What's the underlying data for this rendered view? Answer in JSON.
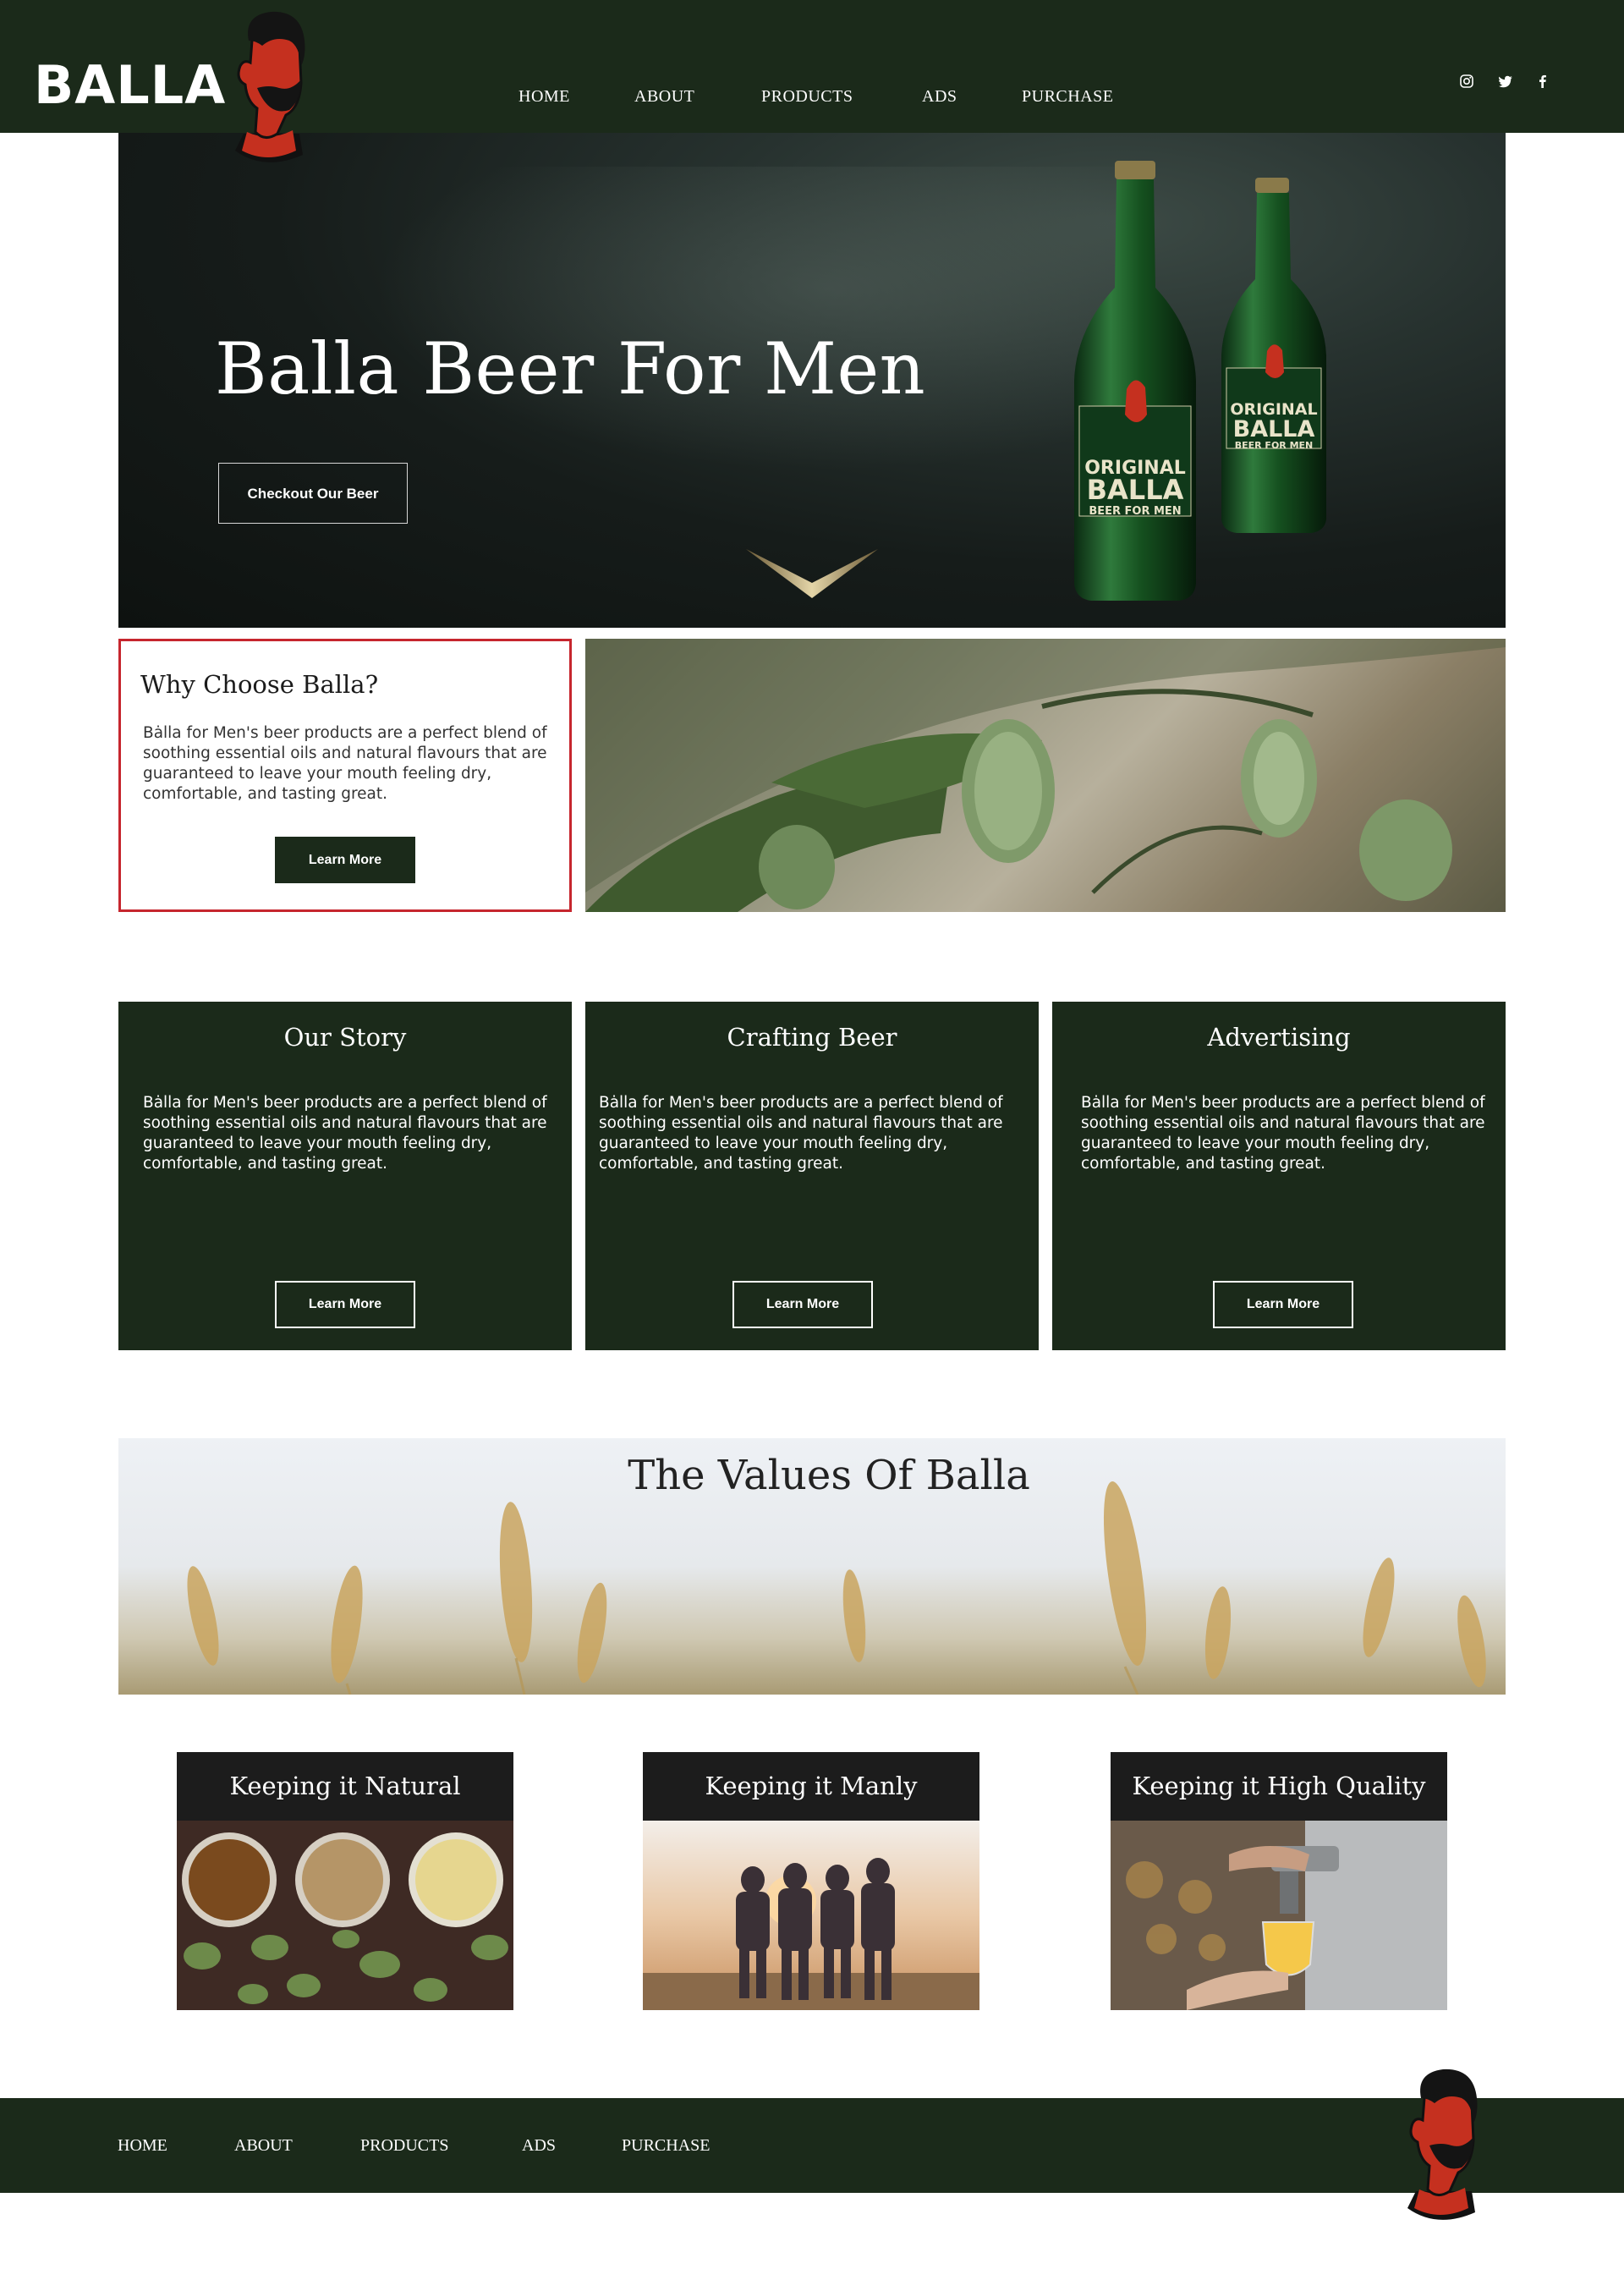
{
  "header": {
    "logo": "BALLA",
    "nav": [
      "HOME",
      "ABOUT",
      "PRODUCTS",
      "ADS",
      "PURCHASE"
    ],
    "social_icons": [
      "instagram-icon",
      "twitter-icon",
      "facebook-icon"
    ]
  },
  "hero": {
    "title": "Balla Beer For Men",
    "button": "Checkout Our Beer",
    "bottle_label_1": "ORIGINAL",
    "bottle_label_2": "BALLA",
    "bottle_label_3": "BEER FOR MEN"
  },
  "why": {
    "title": "Why Choose Balla?",
    "text": "Bȧlla for Men's beer products are a perfect blend of soothing essential oils and natural flavours that are guaranteed to leave your mouth feeling dry, comfortable, and tasting great.",
    "button": "Learn More"
  },
  "cards": [
    {
      "title": "Our Story",
      "text": "Bȧlla for Men's beer products are a perfect blend of soothing essential oils and natural flavours that are guaranteed to leave your mouth feeling dry, comfortable, and tasting great.",
      "button": "Learn More"
    },
    {
      "title": "Crafting Beer",
      "text": "Bȧlla for Men's beer products are a perfect blend of soothing essential oils and natural flavours that are guaranteed to leave your mouth feeling dry, comfortable, and tasting great.",
      "button": "Learn More"
    },
    {
      "title": "Advertising",
      "text": "Bȧlla for Men's beer products are a perfect blend of soothing essential oils and natural flavours that are guaranteed to leave your mouth feeling dry, comfortable, and tasting great.",
      "button": "Learn More"
    }
  ],
  "values": {
    "title": "The Values Of Balla",
    "tiles": [
      {
        "title": "Keeping it Natural"
      },
      {
        "title": "Keeping it Manly"
      },
      {
        "title": "Keeping it High Quality"
      }
    ]
  },
  "footer": {
    "nav": [
      "HOME",
      "ABOUT",
      "PRODUCTS",
      "ADS",
      "PURCHASE"
    ]
  },
  "colors": {
    "brand_green": "#1b2a1a",
    "accent_red": "#c6262e",
    "tile_header": "#1c1c1c"
  }
}
